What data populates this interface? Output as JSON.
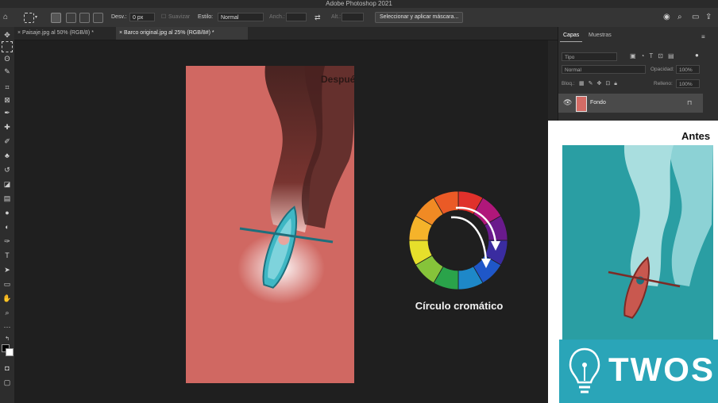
{
  "app": {
    "title": "Adobe Photoshop 2021"
  },
  "options_bar": {
    "desv_label": "Desv.:",
    "desv_value": "0 px",
    "suavizar_label": "Suavizar",
    "estilo_label": "Estilo:",
    "estilo_value": "Normal",
    "anch_label": "Anch.:",
    "alt_label": "Alt.:",
    "select_mask_button": "Seleccionar y aplicar máscara..."
  },
  "tabs": [
    {
      "label": "Paisaje.jpg al 50% (RGB/8) *"
    },
    {
      "label": "Barco original.jpg al 25% (RGB/8#) *"
    }
  ],
  "canvas": {
    "after_label": "Después",
    "wheel_label": "Círculo cromático",
    "wheel_colors": [
      "#e0312b",
      "#b0177a",
      "#6a1a8c",
      "#3a2ca0",
      "#1f57c8",
      "#1e88c8",
      "#2aa34a",
      "#86c33a",
      "#e6df2b",
      "#f5b32a",
      "#f08a24",
      "#ea5a26"
    ]
  },
  "layers_panel": {
    "tab_layers": "Capas",
    "tab_samples": "Muestras",
    "kind_filter": "Tipo",
    "blend_mode": "Normal",
    "opacity_label": "Opacidad:",
    "opacity_value": "100%",
    "lock_label": "Bloq.:",
    "fill_label": "Relleno:",
    "fill_value": "100%",
    "layer_name": "Fondo"
  },
  "reference": {
    "before_label": "Antes"
  },
  "watermark": {
    "brand": "TWOS"
  },
  "colors": {
    "accent": "#2aa5b8",
    "doc_red": "#d46c66",
    "teal": "#2a9ea3"
  }
}
